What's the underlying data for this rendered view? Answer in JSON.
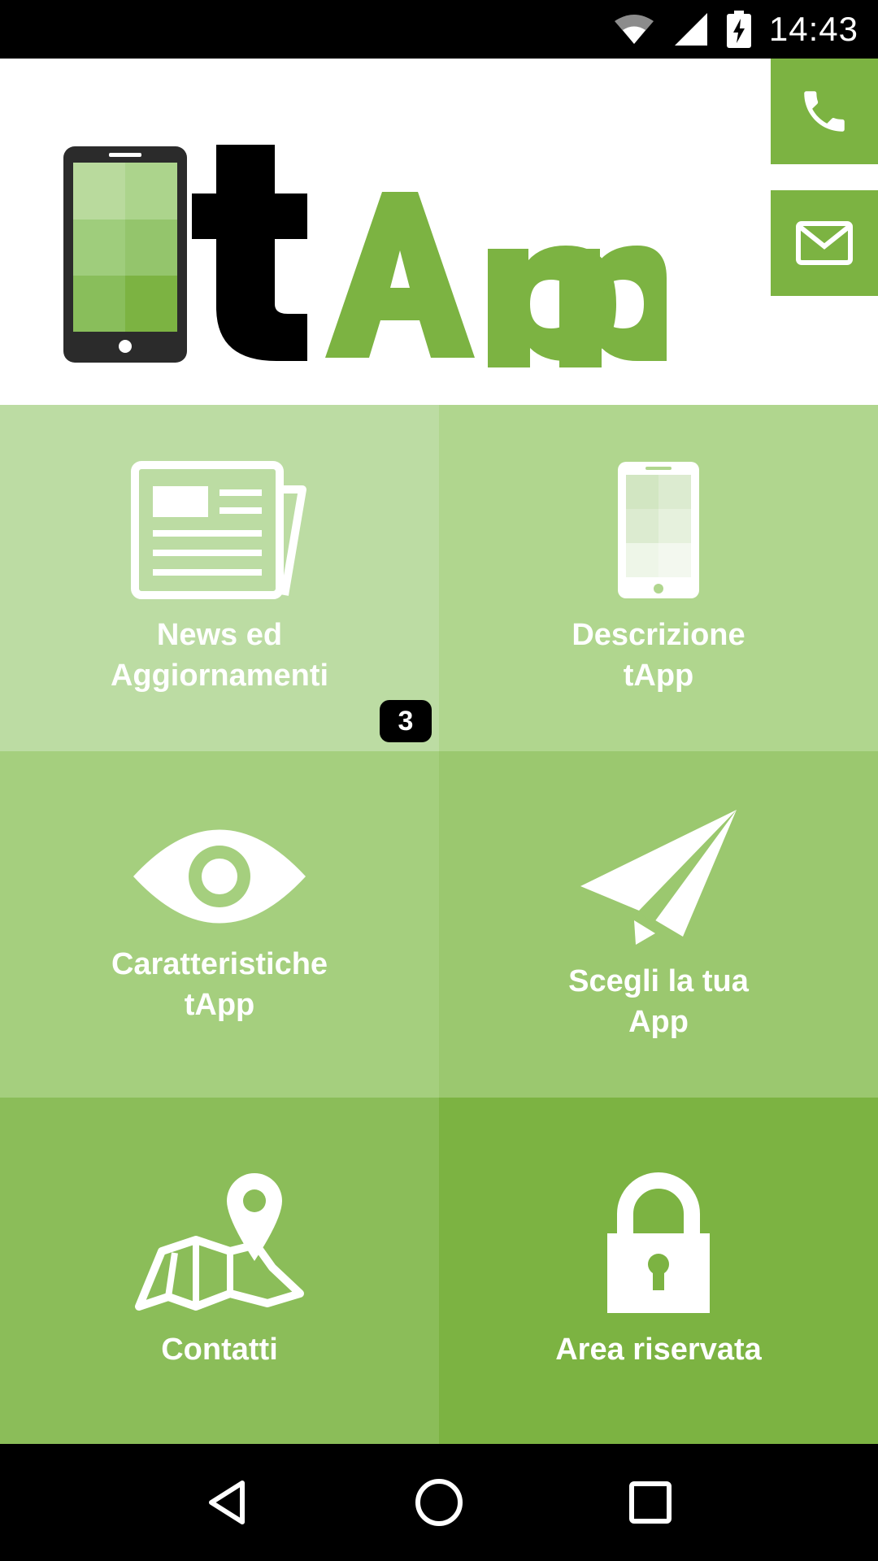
{
  "status_bar": {
    "time": "14:43",
    "icons": [
      "wifi-icon",
      "signal-icon",
      "battery-charging-icon"
    ]
  },
  "header": {
    "logo_text": "tApp",
    "quick_actions": [
      {
        "name": "call",
        "icon": "phone-icon"
      },
      {
        "name": "mail",
        "icon": "mail-icon"
      }
    ]
  },
  "menu": {
    "tiles": [
      {
        "label": "News ed\nAggiornamenti",
        "icon": "newspaper-icon",
        "badge": "3"
      },
      {
        "label": "Descrizione\ntApp",
        "icon": "smartphone-icon"
      },
      {
        "label": "Caratteristiche\ntApp",
        "icon": "eye-icon"
      },
      {
        "label": "Scegli la tua\nApp",
        "icon": "paper-plane-icon"
      },
      {
        "label": "Contatti",
        "icon": "map-pin-icon"
      },
      {
        "label": "Area riservata",
        "icon": "lock-icon"
      }
    ]
  },
  "colors": {
    "brand_green": "#7cb342",
    "logo_dark": "#000000",
    "phone_frame": "#2b2b2b"
  },
  "nav_bar": {
    "buttons": [
      "back-icon",
      "home-icon",
      "recents-icon"
    ]
  }
}
